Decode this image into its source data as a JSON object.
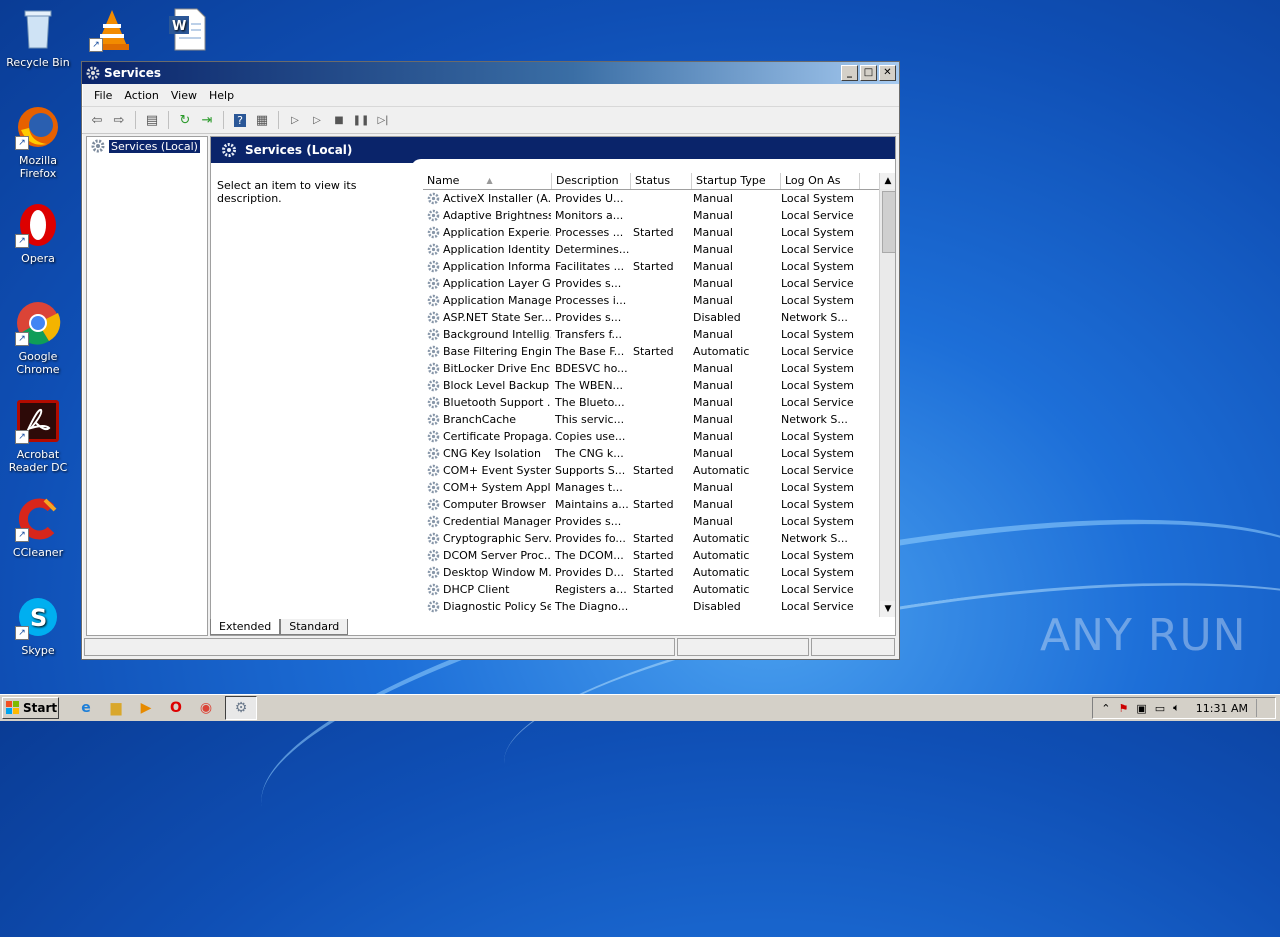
{
  "desktop": {
    "icons": [
      {
        "label": "Recycle Bin",
        "icon": "recycle-bin-icon"
      },
      {
        "label": "Mozilla Firefox",
        "icon": "firefox-icon"
      },
      {
        "label": "Opera",
        "icon": "opera-icon"
      },
      {
        "label": "Google Chrome",
        "icon": "chrome-icon"
      },
      {
        "label": "Acrobat Reader DC",
        "icon": "acrobat-icon"
      },
      {
        "label": "CCleaner",
        "icon": "ccleaner-icon"
      },
      {
        "label": "Skype",
        "icon": "skype-icon"
      }
    ],
    "watermark": "ANY RUN"
  },
  "window": {
    "title": "Services",
    "menu": [
      "File",
      "Action",
      "View",
      "Help"
    ],
    "tree_item": "Services (Local)",
    "pane_title": "Services (Local)",
    "description_prompt": "Select an item to view its description.",
    "columns": [
      "Name",
      "Description",
      "Status",
      "Startup Type",
      "Log On As"
    ],
    "rows": [
      [
        "ActiveX Installer (A...",
        "Provides U...",
        "",
        "Manual",
        "Local System"
      ],
      [
        "Adaptive Brightness",
        "Monitors a...",
        "",
        "Manual",
        "Local Service"
      ],
      [
        "Application Experie...",
        "Processes ...",
        "Started",
        "Manual",
        "Local System"
      ],
      [
        "Application Identity",
        "Determines...",
        "",
        "Manual",
        "Local Service"
      ],
      [
        "Application Informa...",
        "Facilitates ...",
        "Started",
        "Manual",
        "Local System"
      ],
      [
        "Application Layer G...",
        "Provides s...",
        "",
        "Manual",
        "Local Service"
      ],
      [
        "Application Manage...",
        "Processes i...",
        "",
        "Manual",
        "Local System"
      ],
      [
        "ASP.NET State Ser...",
        "Provides s...",
        "",
        "Disabled",
        "Network S..."
      ],
      [
        "Background Intellig...",
        "Transfers f...",
        "",
        "Manual",
        "Local System"
      ],
      [
        "Base Filtering Engine",
        "The Base F...",
        "Started",
        "Automatic",
        "Local Service"
      ],
      [
        "BitLocker Drive Enc...",
        "BDESVC ho...",
        "",
        "Manual",
        "Local System"
      ],
      [
        "Block Level Backup ...",
        "The WBEN...",
        "",
        "Manual",
        "Local System"
      ],
      [
        "Bluetooth Support ...",
        "The Blueto...",
        "",
        "Manual",
        "Local Service"
      ],
      [
        "BranchCache",
        "This servic...",
        "",
        "Manual",
        "Network S..."
      ],
      [
        "Certificate Propaga...",
        "Copies use...",
        "",
        "Manual",
        "Local System"
      ],
      [
        "CNG Key Isolation",
        "The CNG k...",
        "",
        "Manual",
        "Local System"
      ],
      [
        "COM+ Event System",
        "Supports S...",
        "Started",
        "Automatic",
        "Local Service"
      ],
      [
        "COM+ System Appl...",
        "Manages t...",
        "",
        "Manual",
        "Local System"
      ],
      [
        "Computer Browser",
        "Maintains a...",
        "Started",
        "Manual",
        "Local System"
      ],
      [
        "Credential Manager",
        "Provides s...",
        "",
        "Manual",
        "Local System"
      ],
      [
        "Cryptographic Serv...",
        "Provides fo...",
        "Started",
        "Automatic",
        "Network S..."
      ],
      [
        "DCOM Server Proc...",
        "The DCOM...",
        "Started",
        "Automatic",
        "Local System"
      ],
      [
        "Desktop Window M...",
        "Provides D...",
        "Started",
        "Automatic",
        "Local System"
      ],
      [
        "DHCP Client",
        "Registers a...",
        "Started",
        "Automatic",
        "Local Service"
      ],
      [
        "Diagnostic Policy Se...",
        "The Diagno...",
        "",
        "Disabled",
        "Local Service"
      ]
    ],
    "tabs": [
      "Extended",
      "Standard"
    ]
  },
  "taskbar": {
    "start_label": "Start",
    "clock": "11:31 AM"
  }
}
